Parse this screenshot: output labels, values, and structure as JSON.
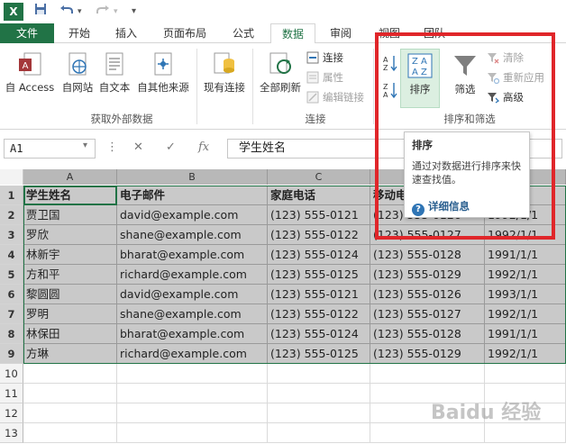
{
  "quick_access": {
    "app_icon": "X",
    "save": "save-icon",
    "undo": "undo-icon",
    "redo": "redo-icon",
    "more": "more-icon"
  },
  "tabs": [
    {
      "label": "文件"
    },
    {
      "label": "开始"
    },
    {
      "label": "插入"
    },
    {
      "label": "页面布局"
    },
    {
      "label": "公式"
    },
    {
      "label": "数据"
    },
    {
      "label": "审阅"
    },
    {
      "label": "视图"
    },
    {
      "label": "团队"
    }
  ],
  "ribbon": {
    "external_data": {
      "group_label": "获取外部数据",
      "access": "自 Access",
      "web": "自网站",
      "text": "自文本",
      "other": "自其他来源",
      "existing": "现有连接"
    },
    "connections": {
      "group_label": "连接",
      "refresh_all": "全部刷新",
      "connections": "连接",
      "properties": "属性",
      "edit_links": "编辑链接"
    },
    "sort_filter": {
      "group_label": "排序和筛选",
      "sort": "排序",
      "filter": "筛选",
      "clear": "清除",
      "reapply": "重新应用",
      "advanced": "高级"
    }
  },
  "formula_bar": {
    "name_box": "A1",
    "fx": "fx",
    "value": "学生姓名"
  },
  "tooltip": {
    "title": "排序",
    "body": "通过对数据进行排序来快速查找值。",
    "link": "详细信息"
  },
  "grid": {
    "columns": [
      "A",
      "B",
      "C",
      "D",
      "E"
    ],
    "rows": [
      [
        "学生姓名",
        "电子邮件",
        "家庭电话",
        "移动电话",
        "生日"
      ],
      [
        "贾卫国",
        "david@example.com",
        "(123) 555-0121",
        "(123) 555-0126",
        "1992/1/1"
      ],
      [
        "罗欣",
        "shane@example.com",
        "(123) 555-0122",
        "(123) 555-0127",
        "1992/1/1"
      ],
      [
        "林新宇",
        "bharat@example.com",
        "(123) 555-0124",
        "(123) 555-0128",
        "1991/1/1"
      ],
      [
        "方和平",
        "richard@example.com",
        "(123) 555-0125",
        "(123) 555-0129",
        "1992/1/1"
      ],
      [
        "黎圆圆",
        "david@example.com",
        "(123) 555-0121",
        "(123) 555-0126",
        "1993/1/1"
      ],
      [
        "罗明",
        "shane@example.com",
        "(123) 555-0122",
        "(123) 555-0127",
        "1992/1/1"
      ],
      [
        "林保田",
        "bharat@example.com",
        "(123) 555-0124",
        "(123) 555-0128",
        "1991/1/1"
      ],
      [
        "方琳",
        "richard@example.com",
        "(123) 555-0125",
        "(123) 555-0129",
        "1992/1/1"
      ]
    ],
    "row_numbers": [
      "1",
      "2",
      "3",
      "4",
      "5",
      "6",
      "7",
      "8",
      "9",
      "10",
      "11",
      "12",
      "13"
    ]
  },
  "watermark": "Baidu 经验",
  "colors": {
    "excel_green": "#217346",
    "highlight_red": "#e0262a",
    "selection_gray": "#c9c9c9"
  }
}
